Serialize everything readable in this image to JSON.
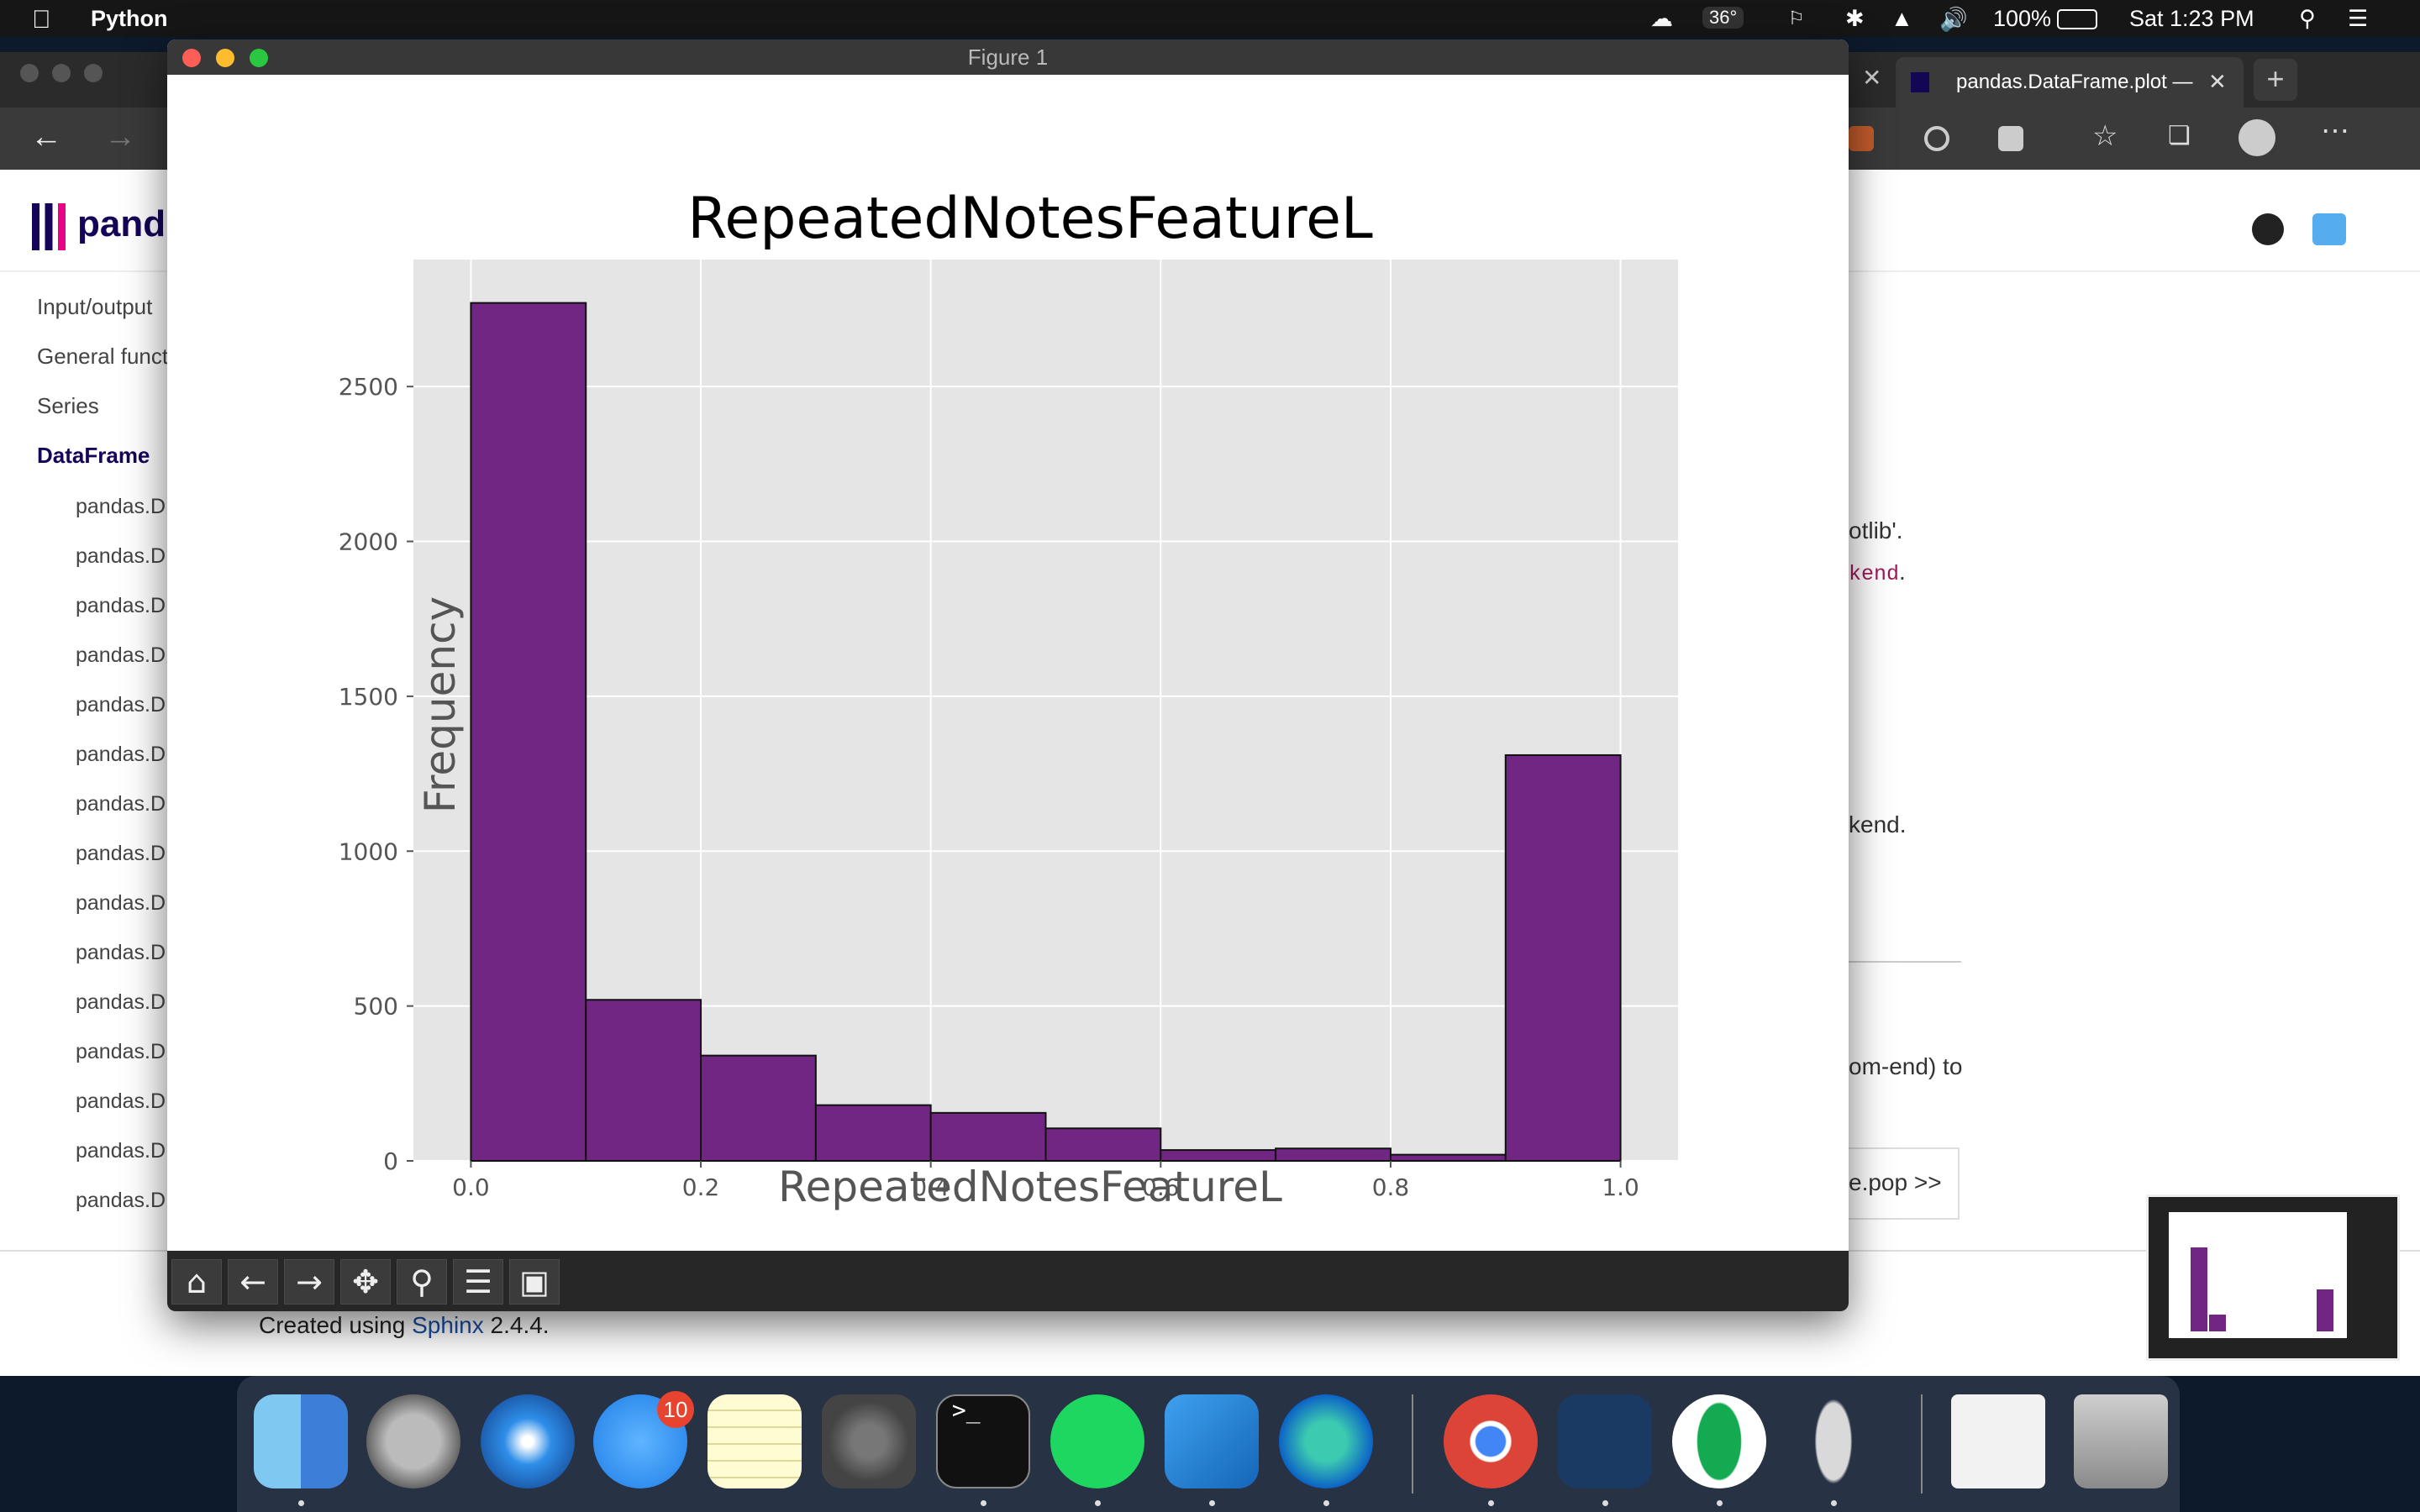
{
  "menubar": {
    "app_name": "Python",
    "temperature": "36°",
    "battery": "100%",
    "clock": "Sat 1:23 PM"
  },
  "browser": {
    "tab_title": "pandas.DataFrame.plot —",
    "sidebar_items": [
      "Input/output",
      "General funct",
      "Series",
      "DataFrame"
    ],
    "sub_items": [
      "pandas.D",
      "pandas.D",
      "pandas.D",
      "pandas.D",
      "pandas.D",
      "pandas.D",
      "pandas.D",
      "pandas.D",
      "pandas.D",
      "pandas.D",
      "pandas.D",
      "pandas.D",
      "pandas.D",
      "pandas.D",
      "pandas.D"
    ],
    "brand": "pand",
    "doc_fragments": {
      "f1": "otlib'.",
      "f2": "kend",
      "f2_tail": ".",
      "f3": "kend.",
      "f4": "om-end) to",
      "f5": "e.pop >>"
    },
    "footer_prefix": "Created using",
    "footer_link": "Sphinx",
    "footer_suffix": "2.4.4."
  },
  "figure": {
    "window_title": "Figure 1"
  },
  "dock": {
    "messages_badge": "10"
  },
  "colors": {
    "bar": "#722683",
    "plot_bg": "#e5e5e5",
    "accent": "#1a4fa3"
  },
  "chart_data": {
    "type": "bar",
    "title": "RepeatedNotesFeatureL",
    "xlabel": "RepeatedNotesFeatureL",
    "ylabel": "Frequency",
    "bin_edges": [
      0.0,
      0.1,
      0.2,
      0.3,
      0.4,
      0.5,
      0.6,
      0.7,
      0.8,
      0.9,
      1.0
    ],
    "values": [
      2770,
      520,
      340,
      180,
      155,
      105,
      35,
      40,
      20,
      1310
    ],
    "xlim": [
      -0.05,
      1.05
    ],
    "ylim": [
      0,
      2910
    ],
    "xticks": [
      "0.0",
      "0.2",
      "0.4",
      "0.6",
      "0.8",
      "1.0"
    ],
    "yticks": [
      "0",
      "500",
      "1000",
      "1500",
      "2000",
      "2500"
    ],
    "grid": true
  }
}
